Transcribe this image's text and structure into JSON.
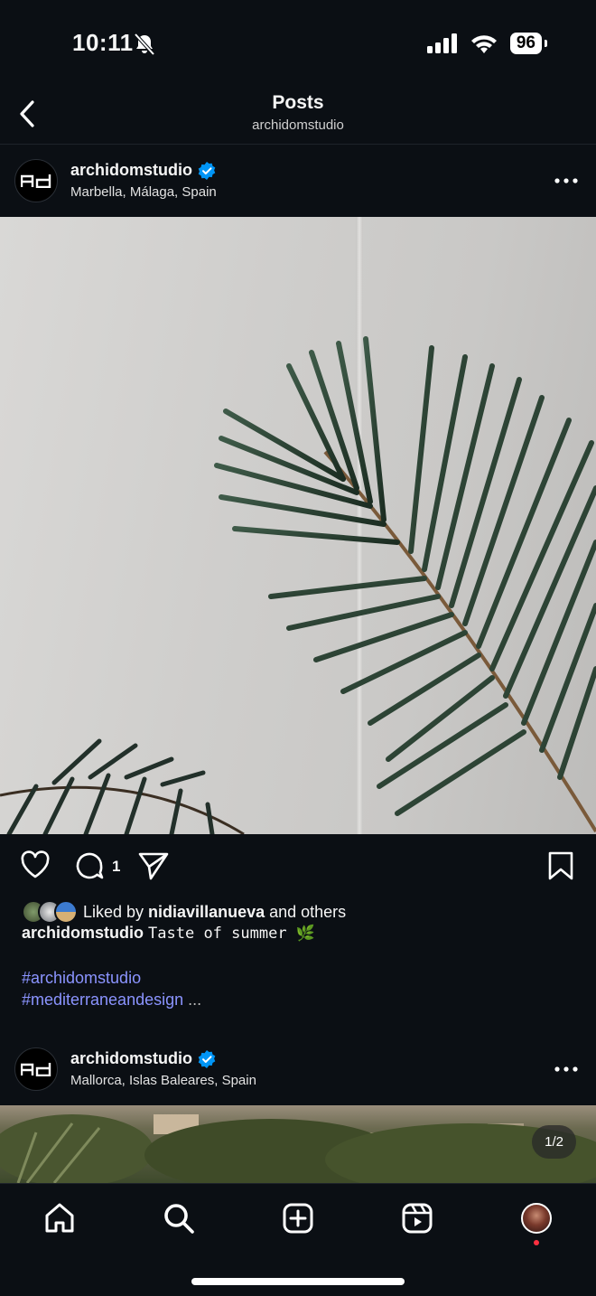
{
  "status_bar": {
    "time": "10:11",
    "battery": "96",
    "icons": [
      "bell-slash-icon",
      "cellular-signal-icon",
      "wifi-icon",
      "battery-icon"
    ]
  },
  "header": {
    "title": "Posts",
    "subtitle": "archidomstudio"
  },
  "posts": [
    {
      "username": "archidomstudio",
      "verified": true,
      "location": "Marbella, Málaga, Spain",
      "comment_count": "1",
      "liked_by_prefix": "Liked by ",
      "liked_by_user": "nidiavillanueva",
      "liked_by_suffix": " and others",
      "caption_user": "archidomstudio",
      "caption_text": "Taste of summer 🌿",
      "hashtags": [
        "#archidomstudio",
        "#mediterraneandesign"
      ],
      "more": "..."
    },
    {
      "username": "archidomstudio",
      "verified": true,
      "location": "Mallorca, Islas Baleares, Spain",
      "image_counter": "1/2"
    }
  ],
  "nav": [
    "home-icon",
    "search-icon",
    "create-icon",
    "reels-icon",
    "profile-avatar"
  ],
  "colors": {
    "background": "#0b0f14",
    "verified": "#0095f6",
    "hashtag": "#8b94ff",
    "notification_dot": "#ff3040"
  }
}
